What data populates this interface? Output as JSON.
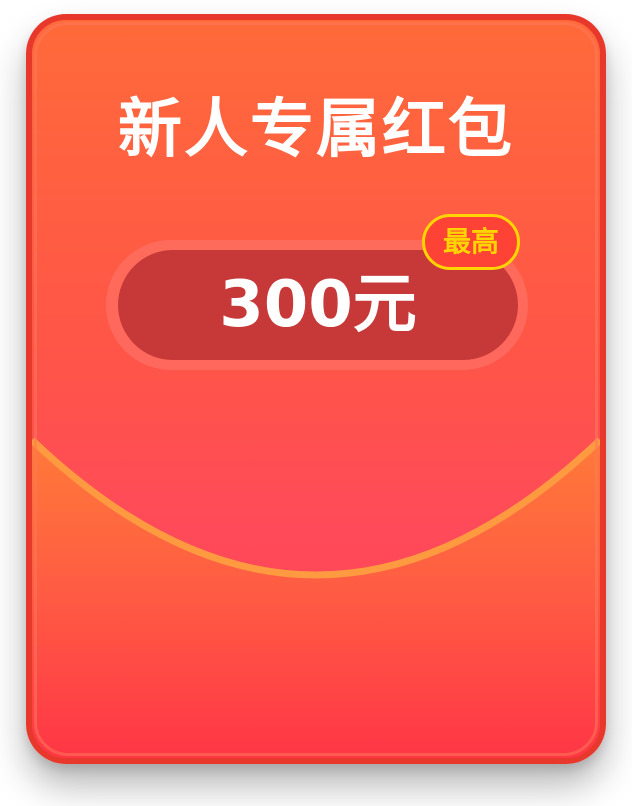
{
  "redpacket": {
    "title": "新人专属红包",
    "amount": "300元",
    "badge": "最高"
  },
  "colors": {
    "card_border": "#e8382c",
    "card_top": "#ff6a3a",
    "card_bottom": "#ff3a4a",
    "flap_edge": "#ff8a3a",
    "amount_pill": "#c73838",
    "badge_border": "#ffd400",
    "badge_text": "#ffd400"
  }
}
